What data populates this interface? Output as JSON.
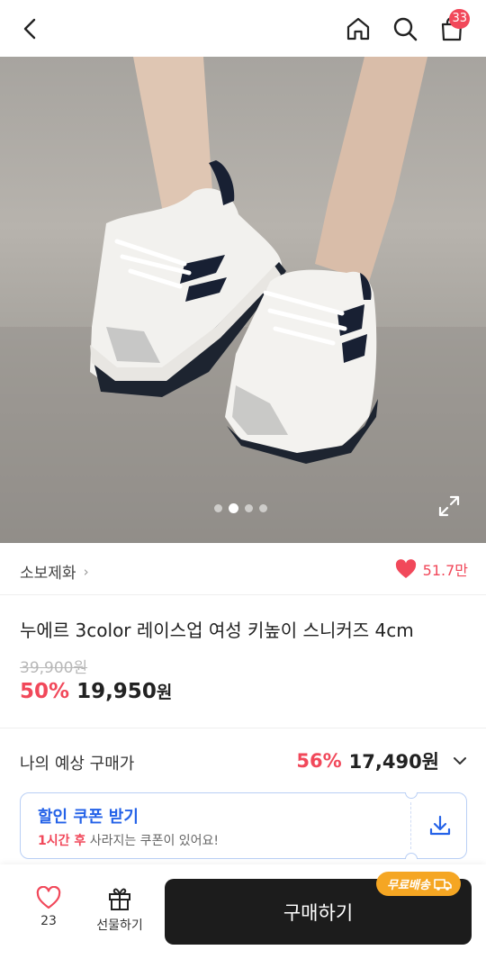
{
  "header": {
    "cart_count": "33",
    "icons": [
      "back-icon",
      "home-icon",
      "search-icon",
      "shopping-bag-icon"
    ]
  },
  "hero": {
    "slide_count": 4,
    "active_slide": 2,
    "icons": [
      "expand-icon"
    ]
  },
  "store": {
    "name": "소보제화",
    "chevron": "›",
    "likes": "51.7만",
    "like_color": "#f1485a"
  },
  "product": {
    "title": "누에르 3color 레이스업 여성 키높이 스니커즈 4cm",
    "original_price": "39,900원",
    "discount_rate": "50%",
    "sale_price": "19,950",
    "currency": "원"
  },
  "expected": {
    "label": "나의 예상 구매가",
    "rate": "56%",
    "price": "17,490원"
  },
  "coupon": {
    "title": "할인 쿠폰 받기",
    "time_highlight": "1시간 후",
    "sub_text": " 사라지는 쿠폰이 있어요!",
    "accent": "#2462e8"
  },
  "bottom": {
    "wish_count": "23",
    "gift_label": "선물하기",
    "buy_label": "구매하기",
    "free_shipping": "무료배송",
    "buy_color": "#1c1c1c",
    "badge_color": "#f5a623"
  }
}
